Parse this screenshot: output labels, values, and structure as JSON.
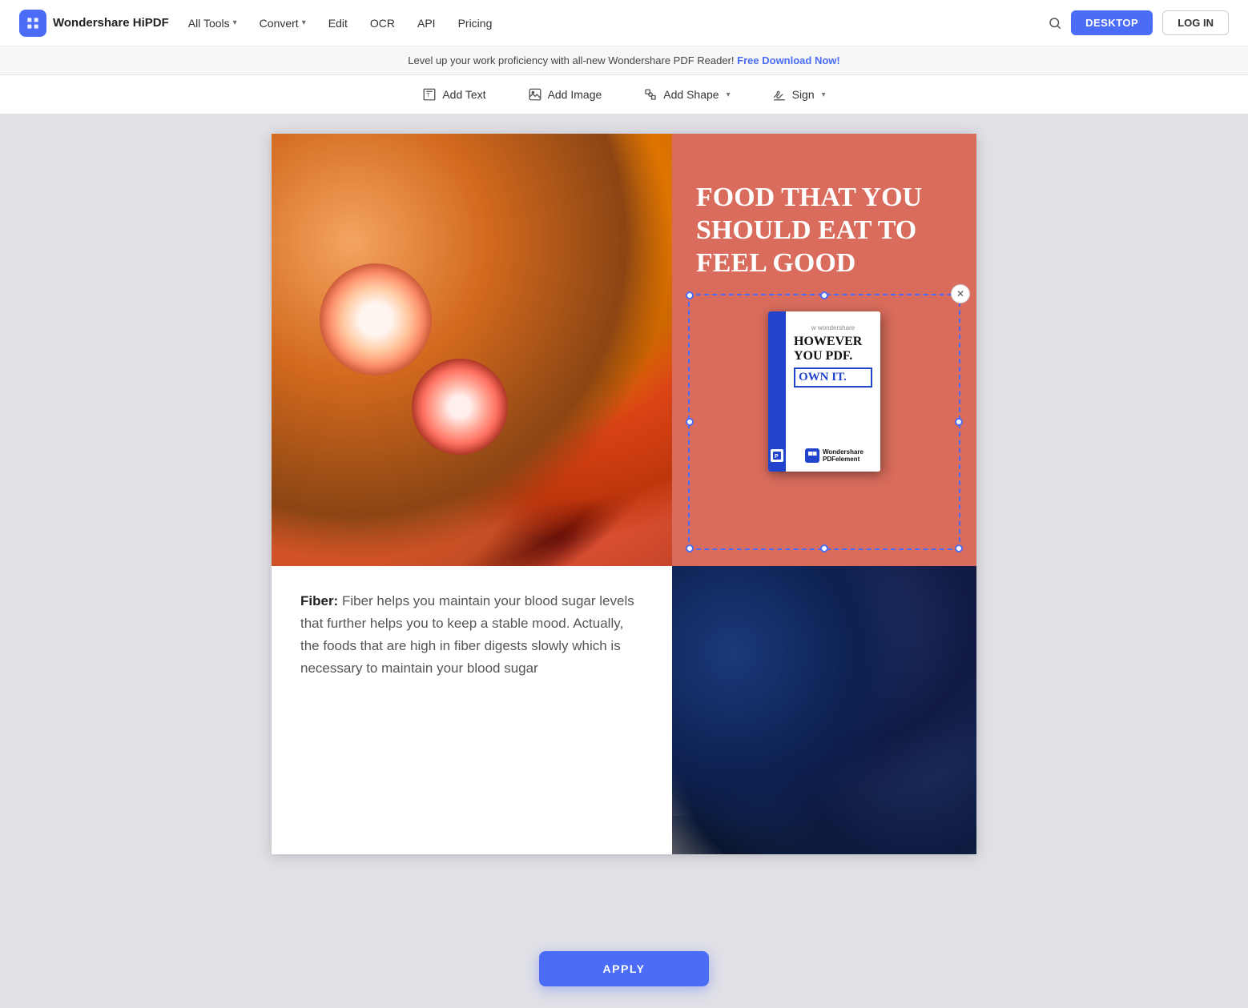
{
  "navbar": {
    "logo_text": "Wondershare HiPDF",
    "all_tools_label": "All Tools",
    "convert_label": "Convert",
    "edit_label": "Edit",
    "ocr_label": "OCR",
    "api_label": "API",
    "pricing_label": "Pricing",
    "desktop_btn": "DESKTOP",
    "login_btn": "LOG IN"
  },
  "promo_banner": {
    "text": "Level up your work proficiency with all-new Wondershare PDF Reader!",
    "cta": "Free Download Now!"
  },
  "toolbar": {
    "add_text_label": "Add Text",
    "add_image_label": "Add Image",
    "add_shape_label": "Add Shape",
    "sign_label": "Sign"
  },
  "pdf_content": {
    "headline": "FOOD THAT YOU SHOULD EAT TO FEEL GOOD",
    "fiber_label": "Fiber:",
    "fiber_text": "Fiber helps you maintain your blood sugar levels that further helps you to keep a stable mood. Actually, the foods that are high in fiber digests slowly which is necessary to maintain your blood sugar",
    "book_however": "HOWEVER",
    "book_you": "YOU PDF.",
    "book_own": "OWN IT.",
    "book_brand": "Wondershare\nPDFelement",
    "book_w": "w wondershare"
  },
  "apply_btn": "APPLY"
}
